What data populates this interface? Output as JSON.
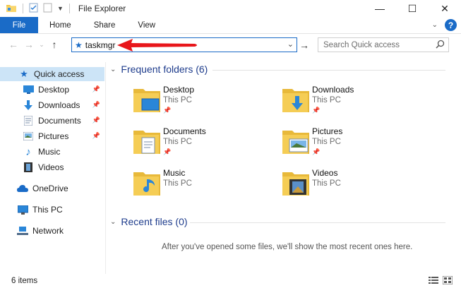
{
  "window": {
    "title": "File Explorer",
    "controls": {
      "minimize": "—",
      "maximize": "☐",
      "close": "✕"
    }
  },
  "ribbon": {
    "tabs": [
      "File",
      "Home",
      "Share",
      "View"
    ],
    "help": "?"
  },
  "address": {
    "value": "taskmgr",
    "search_placeholder": "Search Quick access"
  },
  "nav": {
    "items": [
      {
        "label": "Quick access",
        "icon": "star-icon",
        "selected": true
      },
      {
        "label": "Desktop",
        "icon": "desktop-folder-icon",
        "pinned": true
      },
      {
        "label": "Downloads",
        "icon": "downloads-icon",
        "pinned": true
      },
      {
        "label": "Documents",
        "icon": "documents-icon",
        "pinned": true
      },
      {
        "label": "Pictures",
        "icon": "pictures-icon",
        "pinned": true
      },
      {
        "label": "Music",
        "icon": "music-icon"
      },
      {
        "label": "Videos",
        "icon": "videos-icon"
      },
      {
        "label": "OneDrive",
        "icon": "onedrive-icon"
      },
      {
        "label": "This PC",
        "icon": "pc-icon"
      },
      {
        "label": "Network",
        "icon": "network-icon"
      }
    ]
  },
  "content": {
    "frequent_header": "Frequent folders (6)",
    "recent_header": "Recent files (0)",
    "folders": [
      {
        "name": "Desktop",
        "location": "This PC",
        "pinned": true,
        "overlay": "desktop"
      },
      {
        "name": "Downloads",
        "location": "This PC",
        "pinned": true,
        "overlay": "download"
      },
      {
        "name": "Documents",
        "location": "This PC",
        "pinned": true,
        "overlay": "document"
      },
      {
        "name": "Pictures",
        "location": "This PC",
        "pinned": true,
        "overlay": "picture"
      },
      {
        "name": "Music",
        "location": "This PC",
        "pinned": false,
        "overlay": "music"
      },
      {
        "name": "Videos",
        "location": "This PC",
        "pinned": false,
        "overlay": "video"
      }
    ],
    "empty_message": "After you've opened some files, we'll show the most recent ones here."
  },
  "status": {
    "item_count": "6 items"
  },
  "colors": {
    "accent": "#1a6bc7",
    "selection": "#cce4f7",
    "group_header": "#1e3c8c",
    "annotation_arrow": "#e8161b"
  }
}
